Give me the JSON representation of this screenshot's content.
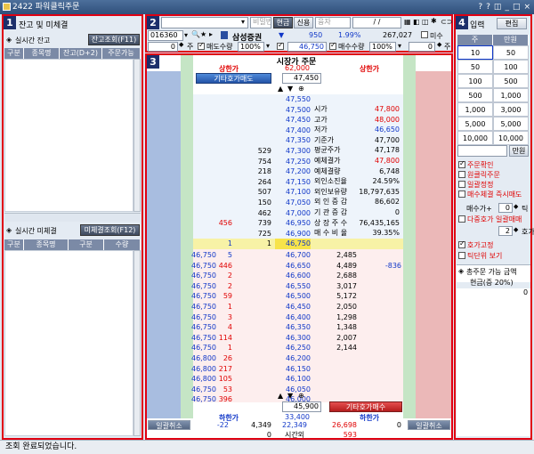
{
  "window": {
    "title": "2422 파워클릭주문",
    "ctrl_btns": [
      "?",
      "?",
      "◫",
      "_",
      "□",
      "×"
    ]
  },
  "panel1": {
    "num": "1",
    "header": "잔고 및 미체결",
    "balance_title": "실시간 잔고",
    "balance_btn": "잔고조회(F11)",
    "balance_cols": [
      "구분",
      "종목명",
      "잔고(D+2)",
      "주문가능"
    ],
    "unfilled_title": "실시간 미체결",
    "unfilled_btn": "미체결조회(F12)",
    "unfilled_cols": [
      "구분",
      "종목명",
      "구분",
      "수량"
    ]
  },
  "panel2": {
    "num": "2",
    "search_ph": "",
    "pw_ph": "비밀번호",
    "cash_btn": "현금",
    "credit_btn": "신용",
    "user_ph": "융자",
    "date_ph": "/ /",
    "code": "016360",
    "stock_name": "삼성증권",
    "change_arrow": "▼",
    "change": "950",
    "change_pct": "1.99%",
    "volume": "267,027",
    "not_filled": "미수",
    "qty_val": "0",
    "unit": "주",
    "sell_qty": "매도수량",
    "pct1": "100%",
    "price": "46,750",
    "buy_qty": "매수수량",
    "pct2": "100%",
    "qty2": "0",
    "unit2": "주"
  },
  "panel3": {
    "num": "3",
    "title": "시장가 주문",
    "upper_left": "상한가",
    "upper_mid": "62,000",
    "upper_right": "상한가",
    "sell_btn": "기타호가매도",
    "top_price": "47,450",
    "buy_btn": "기타호가매수",
    "bot_price": "45,900",
    "lower_left": "하한가",
    "lower_mid": "33,400",
    "lower_right": "하한가",
    "cancel_left": "일괄취소",
    "cancel_right": "일괄취소",
    "foot1": [
      "-22",
      "4,349",
      "22,349",
      "26,698",
      "0"
    ],
    "foot2": [
      "0",
      "",
      "시간외",
      "593",
      ""
    ],
    "ask_rows": [
      {
        "qty": "",
        "price": "47,550"
      },
      {
        "qty": "",
        "price": "47,500"
      },
      {
        "qty": "",
        "price": "47,450"
      },
      {
        "qty": "",
        "price": "47,400"
      },
      {
        "qty": "",
        "price": "47,350"
      },
      {
        "qty": "529",
        "price": "47,300"
      },
      {
        "qty": "754",
        "price": "47,250"
      },
      {
        "qty": "218",
        "price": "47,200"
      },
      {
        "qty": "264",
        "price": "47,150"
      },
      {
        "qty": "507",
        "price": "47,100"
      },
      {
        "qty": "150",
        "price": "47,050"
      },
      {
        "qty": "462",
        "price": "47,000"
      },
      {
        "qty": "739",
        "price": "46,950",
        "mine": "456"
      },
      {
        "qty": "725",
        "price": "46,900"
      },
      {
        "qty": "1",
        "price": "46,750",
        "mine": "1",
        "cur": true
      }
    ],
    "info": [
      [
        "시가",
        "47,800"
      ],
      [
        "고가",
        "48,000"
      ],
      [
        "저가",
        "46,650"
      ],
      [
        "기준가",
        "47,700"
      ],
      [
        "평균주가",
        "47,178"
      ],
      [
        "예체결가",
        "47,800"
      ],
      [
        "예체결량",
        "6,748"
      ],
      [
        "외인소진율",
        "24.59%"
      ],
      [
        "외인보유량",
        "18,797,635"
      ],
      [
        "외 인 증 감",
        "86,602"
      ],
      [
        "기 관 증 감",
        "0"
      ],
      [
        "상 장 주 수",
        "76,435,165"
      ],
      [
        "매 수 비 율",
        "39.35%"
      ]
    ],
    "bid_rows": [
      {
        "lp": "46,750",
        "lq": "5",
        "price": "46,700",
        "qty": "2,485"
      },
      {
        "lp": "46,750",
        "lq": "446",
        "price": "46,650",
        "qty": "4,489",
        "diff": "-836"
      },
      {
        "lp": "46,750",
        "lq": "2",
        "price": "46,600",
        "qty": "2,688"
      },
      {
        "lp": "46,750",
        "lq": "2",
        "price": "46,550",
        "qty": "3,017"
      },
      {
        "lp": "46,750",
        "lq": "59",
        "price": "46,500",
        "qty": "5,172"
      },
      {
        "lp": "46,750",
        "lq": "1",
        "price": "46,450",
        "qty": "2,050"
      },
      {
        "lp": "46,750",
        "lq": "3",
        "price": "46,400",
        "qty": "1,298"
      },
      {
        "lp": "46,750",
        "lq": "4",
        "price": "46,350",
        "qty": "1,348"
      },
      {
        "lp": "46,750",
        "lq": "114",
        "price": "46,300",
        "qty": "2,007"
      },
      {
        "lp": "46,750",
        "lq": "1",
        "price": "46,250",
        "qty": "2,144"
      },
      {
        "lp": "46,800",
        "lq": "26",
        "price": "46,200",
        "qty": ""
      },
      {
        "lp": "46,800",
        "lq": "217",
        "price": "46,150",
        "qty": ""
      },
      {
        "lp": "46,800",
        "lq": "105",
        "price": "46,100",
        "qty": ""
      },
      {
        "lp": "46,750",
        "lq": "53",
        "price": "46,050",
        "qty": ""
      },
      {
        "lp": "46,750",
        "lq": "396",
        "price": "46,000",
        "qty": ""
      }
    ]
  },
  "panel4": {
    "num": "4",
    "header": "입력",
    "edit_btn": "편집",
    "col_a": "주",
    "col_b": "만원",
    "grid": [
      [
        "10",
        "50"
      ],
      [
        "50",
        "100"
      ],
      [
        "100",
        "500"
      ],
      [
        "500",
        "1,000"
      ],
      [
        "1,000",
        "3,000"
      ],
      [
        "5,000",
        "5,000"
      ],
      [
        "10,000",
        "10,000"
      ]
    ],
    "manwon_btn": "만원",
    "options": [
      {
        "label": "주문확인",
        "on": true,
        "red": true
      },
      {
        "label": "원클릭주문",
        "on": false,
        "red": true
      },
      {
        "label": "일괄정정",
        "on": false,
        "red": true
      },
      {
        "label": "매수체결 즉시매도",
        "on": false,
        "red": true
      }
    ],
    "sell_plus": "매수가+",
    "tick_val": "0",
    "tick": "틱",
    "multi": "다중호가 일괄매매",
    "multi_val": "2",
    "ho": "호가",
    "fixed": "호가고정",
    "tick_view": "틱단위 보기",
    "total_title": "총주문 가능 금액",
    "cash_label": "현금(증 20%)",
    "cash_val": "0"
  },
  "status": "조회 완료되었습니다."
}
